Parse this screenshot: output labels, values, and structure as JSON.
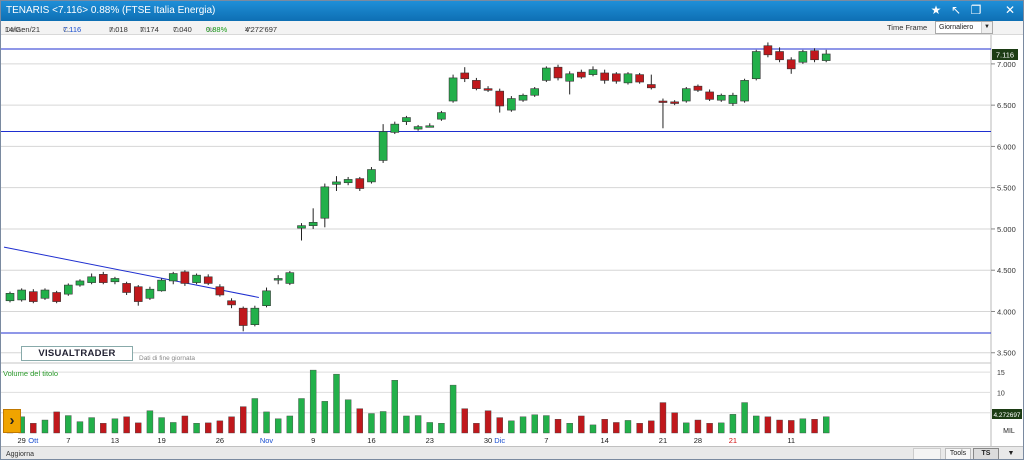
{
  "title": {
    "ticker": "TENARIS",
    "price_change": "<7.116> 0.88%",
    "index": "(FTSE Italia Energia)"
  },
  "titlebar_icons": [
    "star-icon",
    "pin-icon",
    "restore-icon",
    "close-icon"
  ],
  "info": {
    "date_label": "Data:",
    "date_value": "14/Gen/21",
    "close_label": "C:",
    "close_value": "7.116",
    "low_label": "m:",
    "low_value": "7.018",
    "high_label": "M:",
    "high_value": "7.174",
    "open_label": "O:",
    "open_value": "7.040",
    "pct_label": "%:",
    "pct_value": "0.88%",
    "vol_label": "V:",
    "vol_value": "4'272'697"
  },
  "timeframe": {
    "label": "Time Frame",
    "selected": "Giornaliero"
  },
  "branding": {
    "logo": "VISUALTRADER",
    "eod_note": "Dati di fine giornata"
  },
  "volume": {
    "label": "Volume del titolo",
    "unit": "MIL"
  },
  "price_label": "7.116",
  "volume_value_label": "4.272697",
  "statusbar": {
    "refresh": "Aggiorna",
    "tools": "Tools",
    "tsoff": "TS OFF"
  },
  "colors": {
    "up": "#22b04a",
    "down": "#c0181c",
    "trendline": "#1f2fd0",
    "titlebar": "#1480c8",
    "accent": "#f0a400"
  },
  "chart_data": {
    "type": "candlestick",
    "price_axis": {
      "ticks": [
        "3.500",
        "4.000",
        "4.500",
        "5.000",
        "5.500",
        "6.000",
        "6.500",
        "7.000"
      ],
      "range": [
        3.4,
        7.35
      ]
    },
    "volume_axis": {
      "ticks": [
        "5",
        "10",
        "15"
      ],
      "range": [
        0,
        17
      ]
    },
    "x_axis_labels": [
      {
        "label": "29",
        "i": 1,
        "color": "#222"
      },
      {
        "label": "Ott",
        "i": 2,
        "color": "#1a4fd0"
      },
      {
        "label": "7",
        "i": 5,
        "color": "#222"
      },
      {
        "label": "13",
        "i": 9,
        "color": "#222"
      },
      {
        "label": "19",
        "i": 13,
        "color": "#222"
      },
      {
        "label": "26",
        "i": 18,
        "color": "#222"
      },
      {
        "label": "Nov",
        "i": 22,
        "color": "#1a4fd0"
      },
      {
        "label": "9",
        "i": 26,
        "color": "#222"
      },
      {
        "label": "16",
        "i": 31,
        "color": "#222"
      },
      {
        "label": "23",
        "i": 36,
        "color": "#222"
      },
      {
        "label": "30",
        "i": 41,
        "color": "#222"
      },
      {
        "label": "Dic",
        "i": 42,
        "color": "#1a4fd0"
      },
      {
        "label": "7",
        "i": 46,
        "color": "#222"
      },
      {
        "label": "14",
        "i": 51,
        "color": "#222"
      },
      {
        "label": "21",
        "i": 56,
        "color": "#222"
      },
      {
        "label": "28",
        "i": 59,
        "color": "#222"
      },
      {
        "label": "21",
        "i": 62,
        "color": "#d01010"
      },
      {
        "label": "11",
        "i": 67,
        "color": "#222"
      }
    ],
    "candles": [
      [
        4.13,
        4.22,
        4.11,
        4.24
      ],
      [
        4.14,
        4.26,
        4.12,
        4.28
      ],
      [
        4.24,
        4.12,
        4.1,
        4.27
      ],
      [
        4.16,
        4.26,
        4.14,
        4.28
      ],
      [
        4.23,
        4.12,
        4.1,
        4.25
      ],
      [
        4.21,
        4.32,
        4.19,
        4.34
      ],
      [
        4.32,
        4.37,
        4.3,
        4.39
      ],
      [
        4.35,
        4.42,
        4.33,
        4.46
      ],
      [
        4.45,
        4.35,
        4.33,
        4.48
      ],
      [
        4.36,
        4.4,
        4.33,
        4.42
      ],
      [
        4.34,
        4.23,
        4.2,
        4.36
      ],
      [
        4.3,
        4.12,
        4.07,
        4.32
      ],
      [
        4.16,
        4.27,
        4.14,
        4.3
      ],
      [
        4.25,
        4.38,
        4.24,
        4.4
      ],
      [
        4.37,
        4.46,
        4.33,
        4.48
      ],
      [
        4.48,
        4.34,
        4.31,
        4.5
      ],
      [
        4.35,
        4.44,
        4.33,
        4.46
      ],
      [
        4.42,
        4.34,
        4.32,
        4.45
      ],
      [
        4.3,
        4.2,
        4.18,
        4.33
      ],
      [
        4.13,
        4.08,
        4.04,
        4.16
      ],
      [
        4.04,
        3.83,
        3.76,
        4.06
      ],
      [
        3.84,
        4.04,
        3.82,
        4.07
      ],
      [
        4.07,
        4.25,
        4.05,
        4.29
      ],
      [
        4.38,
        4.4,
        4.33,
        4.44
      ],
      [
        4.34,
        4.47,
        4.32,
        4.49
      ],
      [
        5.01,
        5.04,
        4.86,
        5.07
      ],
      [
        5.04,
        5.08,
        5.0,
        5.25
      ],
      [
        5.13,
        5.51,
        5.02,
        5.55
      ],
      [
        5.54,
        5.57,
        5.46,
        5.64
      ],
      [
        5.56,
        5.6,
        5.53,
        5.63
      ],
      [
        5.61,
        5.49,
        5.46,
        5.63
      ],
      [
        5.57,
        5.72,
        5.55,
        5.75
      ],
      [
        5.83,
        6.18,
        5.8,
        6.27
      ],
      [
        6.17,
        6.27,
        6.15,
        6.3
      ],
      [
        6.3,
        6.35,
        6.26,
        6.37
      ],
      [
        6.21,
        6.24,
        6.19,
        6.26
      ],
      [
        6.25,
        6.25,
        6.23,
        6.28
      ],
      [
        6.33,
        6.41,
        6.31,
        6.43
      ],
      [
        6.55,
        6.83,
        6.53,
        6.87
      ],
      [
        6.89,
        6.82,
        6.78,
        6.96
      ],
      [
        6.8,
        6.7,
        6.68,
        6.83
      ],
      [
        6.7,
        6.68,
        6.66,
        6.73
      ],
      [
        6.67,
        6.49,
        6.41,
        6.7
      ],
      [
        6.44,
        6.58,
        6.42,
        6.61
      ],
      [
        6.56,
        6.62,
        6.54,
        6.64
      ],
      [
        6.62,
        6.7,
        6.6,
        6.72
      ],
      [
        6.8,
        6.95,
        6.78,
        6.97
      ],
      [
        6.96,
        6.83,
        6.8,
        6.99
      ],
      [
        6.79,
        6.88,
        6.63,
        6.91
      ],
      [
        6.9,
        6.84,
        6.82,
        6.93
      ],
      [
        6.87,
        6.93,
        6.85,
        6.97
      ],
      [
        6.89,
        6.8,
        6.76,
        6.93
      ],
      [
        6.88,
        6.79,
        6.76,
        6.9
      ],
      [
        6.77,
        6.88,
        6.75,
        6.9
      ],
      [
        6.87,
        6.78,
        6.76,
        6.89
      ],
      [
        6.75,
        6.71,
        6.69,
        6.87
      ],
      [
        6.55,
        6.54,
        6.22,
        6.58
      ],
      [
        6.54,
        6.52,
        6.5,
        6.56
      ],
      [
        6.55,
        6.7,
        6.53,
        6.72
      ],
      [
        6.73,
        6.68,
        6.66,
        6.75
      ],
      [
        6.66,
        6.57,
        6.55,
        6.69
      ],
      [
        6.56,
        6.62,
        6.54,
        6.64
      ],
      [
        6.52,
        6.62,
        6.49,
        6.65
      ],
      [
        6.55,
        6.8,
        6.53,
        6.82
      ],
      [
        6.82,
        7.15,
        6.8,
        7.17
      ],
      [
        7.22,
        7.11,
        7.08,
        7.26
      ],
      [
        7.15,
        7.05,
        7.02,
        7.2
      ],
      [
        7.05,
        6.94,
        6.88,
        7.08
      ],
      [
        7.02,
        7.15,
        7.0,
        7.17
      ],
      [
        7.16,
        7.05,
        7.02,
        7.19
      ],
      [
        7.04,
        7.12,
        7.02,
        7.17
      ]
    ],
    "volumes": [
      2.2,
      4.0,
      2.4,
      3.2,
      5.2,
      4.3,
      2.8,
      3.8,
      2.4,
      3.5,
      4.0,
      2.5,
      5.5,
      3.8,
      2.6,
      4.2,
      2.4,
      2.5,
      3.0,
      4.0,
      6.5,
      8.5,
      5.2,
      3.5,
      4.2,
      8.5,
      15.5,
      7.8,
      14.5,
      8.2,
      6.0,
      4.8,
      5.3,
      13.0,
      4.2,
      4.3,
      2.6,
      2.4,
      11.8,
      6.0,
      2.4,
      5.5,
      3.8,
      3.0,
      4.0,
      4.5,
      4.3,
      3.4,
      2.4,
      4.2,
      2.0,
      3.4,
      2.6,
      3.1,
      2.4,
      3.0,
      7.5,
      5.0,
      2.5,
      3.2,
      2.4,
      2.5,
      4.6,
      7.5,
      4.2,
      4.0,
      3.2,
      3.1,
      3.5,
      3.4,
      4.0
    ],
    "horizontal_lines": [
      7.18,
      6.18,
      3.74
    ],
    "trendline": [
      [
        0,
        4.78
      ],
      [
        21,
        4.17
      ]
    ]
  }
}
